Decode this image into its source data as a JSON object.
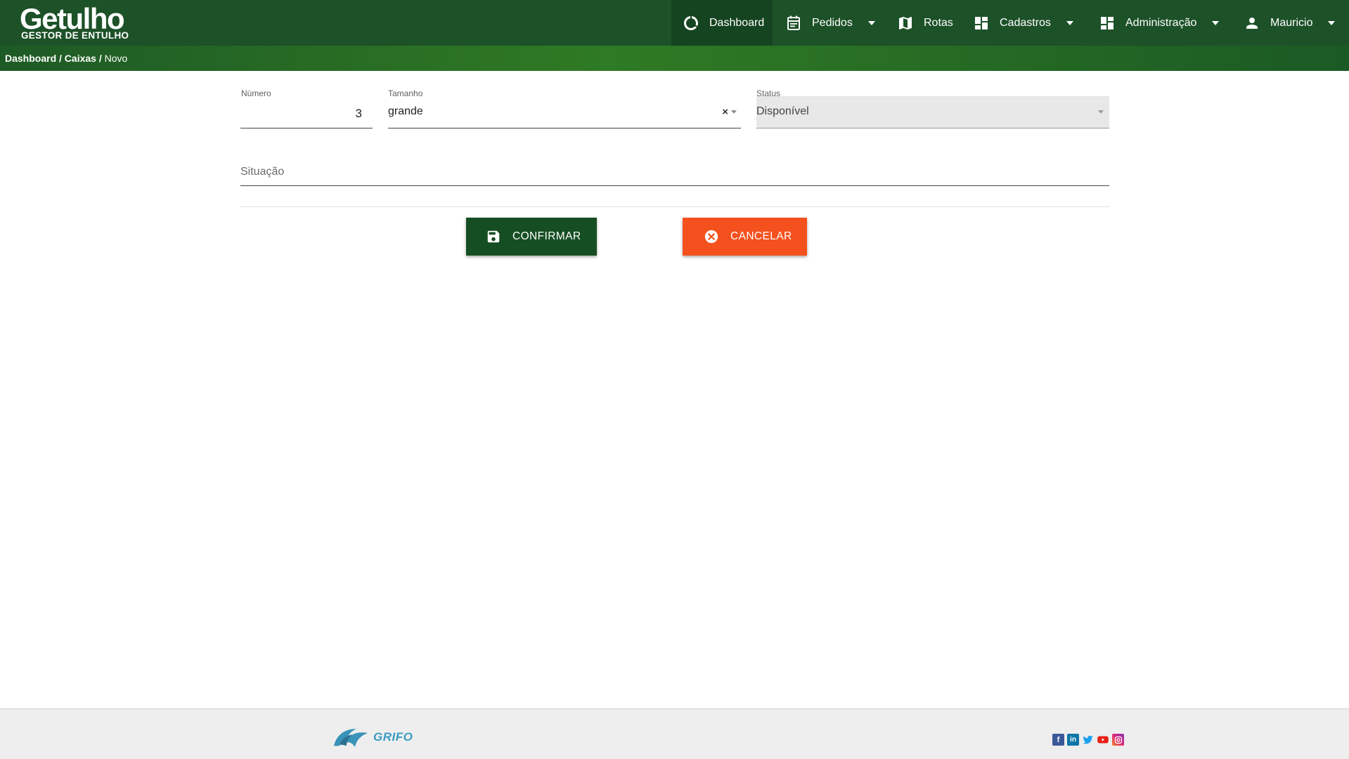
{
  "brand": {
    "name": "Getulho",
    "tagline": "GESTOR DE ENTULHO"
  },
  "nav": {
    "dashboard": {
      "label": "Dashboard",
      "icon": "dashboard-circle-icon"
    },
    "pedidos": {
      "label": "Pedidos",
      "icon": "calendar-icon"
    },
    "rotas": {
      "label": "Rotas",
      "icon": "map-icon"
    },
    "cadastros": {
      "label": "Cadastros",
      "icon": "grid-icon"
    },
    "administracao": {
      "label": "Administração",
      "icon": "dashboard-grid-icon"
    },
    "user": {
      "label": "Mauricio",
      "icon": "person-icon"
    }
  },
  "breadcrumb": {
    "item1": "Dashboard",
    "sep": "/",
    "item2": "Caixas",
    "item3": "Novo"
  },
  "form": {
    "numero": {
      "label": "Número",
      "value": "3"
    },
    "tamanho": {
      "label": "Tamanho",
      "value": "grande"
    },
    "status": {
      "label": "Status",
      "value": "Disponível"
    },
    "situacao": {
      "placeholder": "Situação"
    }
  },
  "actions": {
    "confirm": "CONFIRMAR",
    "cancel": "CANCELAR"
  },
  "footer": {
    "company": "GRIFO",
    "social": [
      "facebook-icon",
      "linkedin-icon",
      "twitter-icon",
      "youtube-icon",
      "instagram-icon"
    ]
  },
  "colors": {
    "nav_bg": "#1d5128",
    "confirm_bg": "#164e23",
    "cancel_bg": "#f4511e"
  }
}
